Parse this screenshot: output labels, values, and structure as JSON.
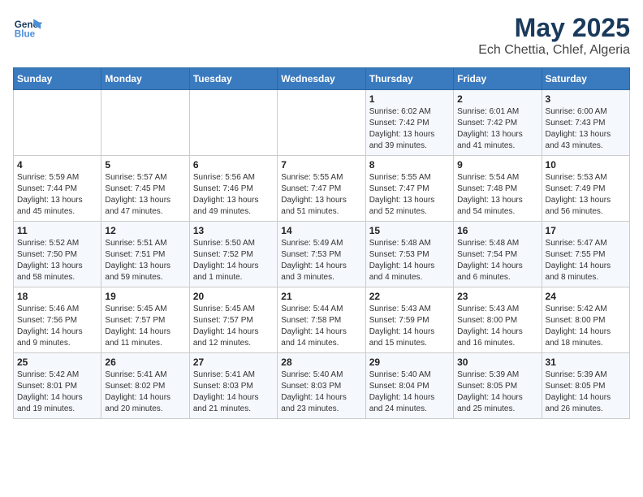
{
  "logo": {
    "line1": "General",
    "line2": "Blue"
  },
  "title": "May 2025",
  "subtitle": "Ech Chettia, Chlef, Algeria",
  "weekdays": [
    "Sunday",
    "Monday",
    "Tuesday",
    "Wednesday",
    "Thursday",
    "Friday",
    "Saturday"
  ],
  "weeks": [
    [
      {
        "day": "",
        "detail": ""
      },
      {
        "day": "",
        "detail": ""
      },
      {
        "day": "",
        "detail": ""
      },
      {
        "day": "",
        "detail": ""
      },
      {
        "day": "1",
        "detail": "Sunrise: 6:02 AM\nSunset: 7:42 PM\nDaylight: 13 hours\nand 39 minutes."
      },
      {
        "day": "2",
        "detail": "Sunrise: 6:01 AM\nSunset: 7:42 PM\nDaylight: 13 hours\nand 41 minutes."
      },
      {
        "day": "3",
        "detail": "Sunrise: 6:00 AM\nSunset: 7:43 PM\nDaylight: 13 hours\nand 43 minutes."
      }
    ],
    [
      {
        "day": "4",
        "detail": "Sunrise: 5:59 AM\nSunset: 7:44 PM\nDaylight: 13 hours\nand 45 minutes."
      },
      {
        "day": "5",
        "detail": "Sunrise: 5:57 AM\nSunset: 7:45 PM\nDaylight: 13 hours\nand 47 minutes."
      },
      {
        "day": "6",
        "detail": "Sunrise: 5:56 AM\nSunset: 7:46 PM\nDaylight: 13 hours\nand 49 minutes."
      },
      {
        "day": "7",
        "detail": "Sunrise: 5:55 AM\nSunset: 7:47 PM\nDaylight: 13 hours\nand 51 minutes."
      },
      {
        "day": "8",
        "detail": "Sunrise: 5:55 AM\nSunset: 7:47 PM\nDaylight: 13 hours\nand 52 minutes."
      },
      {
        "day": "9",
        "detail": "Sunrise: 5:54 AM\nSunset: 7:48 PM\nDaylight: 13 hours\nand 54 minutes."
      },
      {
        "day": "10",
        "detail": "Sunrise: 5:53 AM\nSunset: 7:49 PM\nDaylight: 13 hours\nand 56 minutes."
      }
    ],
    [
      {
        "day": "11",
        "detail": "Sunrise: 5:52 AM\nSunset: 7:50 PM\nDaylight: 13 hours\nand 58 minutes."
      },
      {
        "day": "12",
        "detail": "Sunrise: 5:51 AM\nSunset: 7:51 PM\nDaylight: 13 hours\nand 59 minutes."
      },
      {
        "day": "13",
        "detail": "Sunrise: 5:50 AM\nSunset: 7:52 PM\nDaylight: 14 hours\nand 1 minute."
      },
      {
        "day": "14",
        "detail": "Sunrise: 5:49 AM\nSunset: 7:53 PM\nDaylight: 14 hours\nand 3 minutes."
      },
      {
        "day": "15",
        "detail": "Sunrise: 5:48 AM\nSunset: 7:53 PM\nDaylight: 14 hours\nand 4 minutes."
      },
      {
        "day": "16",
        "detail": "Sunrise: 5:48 AM\nSunset: 7:54 PM\nDaylight: 14 hours\nand 6 minutes."
      },
      {
        "day": "17",
        "detail": "Sunrise: 5:47 AM\nSunset: 7:55 PM\nDaylight: 14 hours\nand 8 minutes."
      }
    ],
    [
      {
        "day": "18",
        "detail": "Sunrise: 5:46 AM\nSunset: 7:56 PM\nDaylight: 14 hours\nand 9 minutes."
      },
      {
        "day": "19",
        "detail": "Sunrise: 5:45 AM\nSunset: 7:57 PM\nDaylight: 14 hours\nand 11 minutes."
      },
      {
        "day": "20",
        "detail": "Sunrise: 5:45 AM\nSunset: 7:57 PM\nDaylight: 14 hours\nand 12 minutes."
      },
      {
        "day": "21",
        "detail": "Sunrise: 5:44 AM\nSunset: 7:58 PM\nDaylight: 14 hours\nand 14 minutes."
      },
      {
        "day": "22",
        "detail": "Sunrise: 5:43 AM\nSunset: 7:59 PM\nDaylight: 14 hours\nand 15 minutes."
      },
      {
        "day": "23",
        "detail": "Sunrise: 5:43 AM\nSunset: 8:00 PM\nDaylight: 14 hours\nand 16 minutes."
      },
      {
        "day": "24",
        "detail": "Sunrise: 5:42 AM\nSunset: 8:00 PM\nDaylight: 14 hours\nand 18 minutes."
      }
    ],
    [
      {
        "day": "25",
        "detail": "Sunrise: 5:42 AM\nSunset: 8:01 PM\nDaylight: 14 hours\nand 19 minutes."
      },
      {
        "day": "26",
        "detail": "Sunrise: 5:41 AM\nSunset: 8:02 PM\nDaylight: 14 hours\nand 20 minutes."
      },
      {
        "day": "27",
        "detail": "Sunrise: 5:41 AM\nSunset: 8:03 PM\nDaylight: 14 hours\nand 21 minutes."
      },
      {
        "day": "28",
        "detail": "Sunrise: 5:40 AM\nSunset: 8:03 PM\nDaylight: 14 hours\nand 23 minutes."
      },
      {
        "day": "29",
        "detail": "Sunrise: 5:40 AM\nSunset: 8:04 PM\nDaylight: 14 hours\nand 24 minutes."
      },
      {
        "day": "30",
        "detail": "Sunrise: 5:39 AM\nSunset: 8:05 PM\nDaylight: 14 hours\nand 25 minutes."
      },
      {
        "day": "31",
        "detail": "Sunrise: 5:39 AM\nSunset: 8:05 PM\nDaylight: 14 hours\nand 26 minutes."
      }
    ]
  ]
}
